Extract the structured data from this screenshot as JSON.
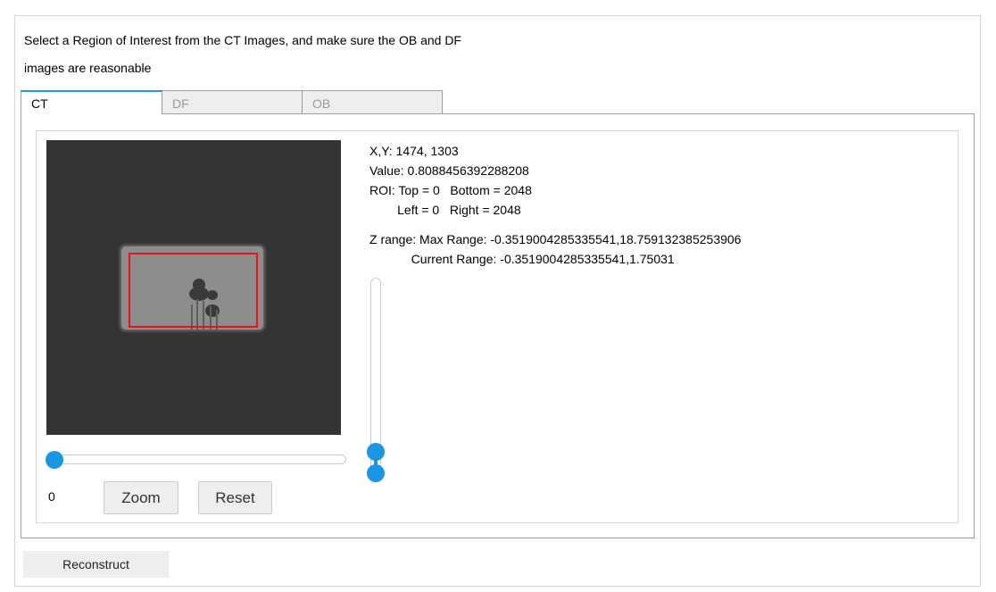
{
  "instructions": {
    "line1": "Select a Region of Interest from the CT Images, and make sure the OB and DF",
    "line2": "images are reasonable"
  },
  "tabs": [
    {
      "label": "CT",
      "active": true
    },
    {
      "label": "DF",
      "active": false
    },
    {
      "label": "OB",
      "active": false
    }
  ],
  "readout": {
    "xy": "X,Y: 1474, 1303",
    "value": "Value: 0.8088456392288208",
    "roi_line1": "ROI: Top = 0   Bottom = 2048",
    "roi_line2": "        Left = 0   Right = 2048",
    "z_range": "Z range: Max Range: -0.3519004285335541,18.759132385253906",
    "current_range": "            Current Range: -0.3519004285335541,1.75031"
  },
  "slice_slider": {
    "value_label": "0",
    "fraction": 0.0
  },
  "buttons": {
    "zoom": "Zoom",
    "reset": "Reset",
    "reconstruct": "Reconstruct"
  },
  "colors": {
    "accent": "#1a96e5",
    "roi": "#e4151c",
    "image_bg": "#333333"
  }
}
